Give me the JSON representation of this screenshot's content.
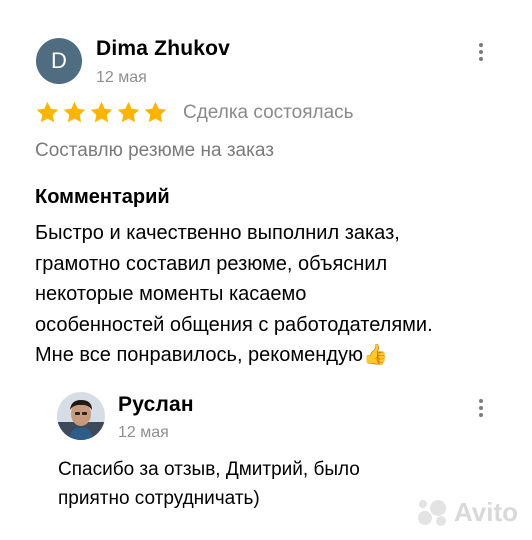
{
  "review": {
    "avatar_letter": "D",
    "author": "Dima Zhukov",
    "date": "12 мая",
    "rating": 5,
    "star_color": "#ffb400",
    "deal_status": "Сделка состоялась",
    "service": "Составлю резюме на заказ",
    "comment_title": "Комментарий",
    "comment_lines": [
      "Быстро и качественно выполнил заказ,",
      "грамотно составил резюме, объяснил",
      "некоторые моменты касаемо",
      "особенностей общения с работодателями.",
      "Мне все понравилось, рекомендую👍"
    ]
  },
  "reply": {
    "author": "Руслан",
    "date": "12 мая",
    "text_lines": [
      "Спасибо за отзыв, Дмитрий, было",
      "приятно сотрудничать)"
    ]
  },
  "watermark": "Avito"
}
